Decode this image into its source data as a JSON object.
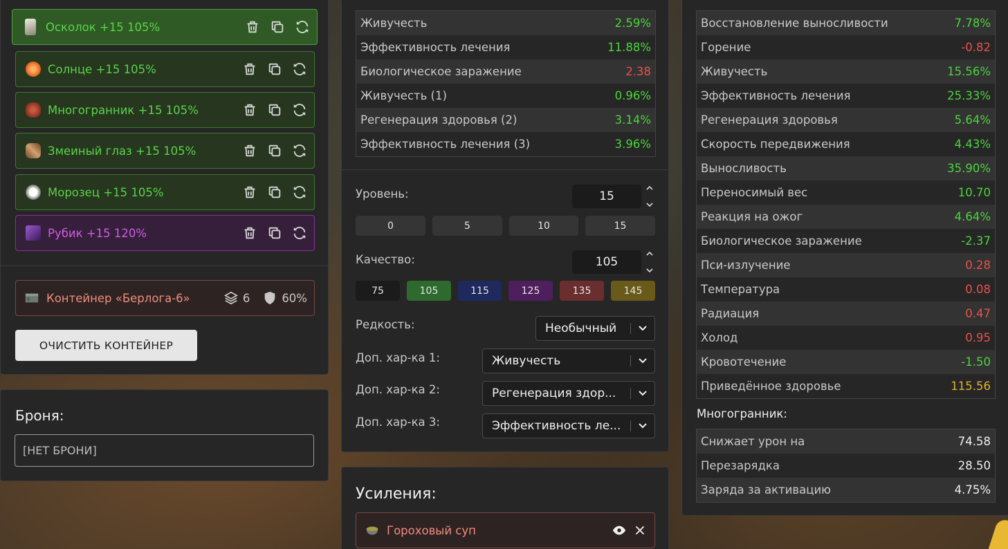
{
  "artifacts": [
    {
      "label": "Осколок +15 105%",
      "icon": "shard-icon",
      "color": "#c9c0b0",
      "style": "active"
    },
    {
      "label": "Солнце +15 105%",
      "icon": "sun-icon",
      "color": "#f08a2c",
      "style": "green"
    },
    {
      "label": "Многогранник +15 105%",
      "icon": "polyhedron-icon",
      "color": "#a8402c",
      "style": "green"
    },
    {
      "label": "Змеиный глаз +15 105%",
      "icon": "snake-eye-icon",
      "color": "#b07a48",
      "style": "green"
    },
    {
      "label": "Морозец +15 105%",
      "icon": "frost-icon",
      "color": "#f4f4f4",
      "style": "green"
    },
    {
      "label": "Рубик +15 120%",
      "icon": "rubik-icon",
      "color": "#7a3a9a",
      "style": "purple"
    }
  ],
  "container": {
    "label": "Контейнер «Берлога-6»",
    "slots": "6",
    "protection": "60%"
  },
  "clear_button": "ОЧИСТИТЬ КОНТЕЙНЕР",
  "armor": {
    "title": "Броня:",
    "value": "[НЕТ БРОНИ]"
  },
  "mid_stats": [
    {
      "label": "Живучесть",
      "value": "2.59%",
      "tone": "green"
    },
    {
      "label": "Эффективность лечения",
      "value": "11.88%",
      "tone": "green"
    },
    {
      "label": "Биологическое заражение",
      "value": "2.38",
      "tone": "red"
    },
    {
      "label": "Живучесть (1)",
      "value": "0.96%",
      "tone": "green"
    },
    {
      "label": "Регенерация здоровья (2)",
      "value": "3.14%",
      "tone": "green"
    },
    {
      "label": "Эффективность лечения (3)",
      "value": "3.96%",
      "tone": "green"
    }
  ],
  "level": {
    "label": "Уровень:",
    "value": "15",
    "presets": [
      "0",
      "5",
      "10",
      "15"
    ]
  },
  "quality": {
    "label": "Качество:",
    "value": "105",
    "presets": [
      {
        "label": "75",
        "color": "#1b1b1b"
      },
      {
        "label": "105",
        "color": "#2e6a2e"
      },
      {
        "label": "115",
        "color": "#1e2a5e"
      },
      {
        "label": "125",
        "color": "#4e1f5c"
      },
      {
        "label": "135",
        "color": "#6a2e2e"
      },
      {
        "label": "145",
        "color": "#6a5a1a"
      }
    ]
  },
  "rarity": {
    "label": "Редкость:",
    "value": "Необычный"
  },
  "extras": [
    {
      "label": "Доп. хар-ка 1:",
      "value": "Живучесть"
    },
    {
      "label": "Доп. хар-ка 2:",
      "value": "Регенерация здор..."
    },
    {
      "label": "Доп. хар-ка 3:",
      "value": "Эффективность ле..."
    }
  ],
  "boosts": {
    "title": "Усиления:",
    "item": "Гороховый суп"
  },
  "right_stats": [
    {
      "label": "Восстановление выносливости",
      "value": "7.78%",
      "tone": "green"
    },
    {
      "label": "Горение",
      "value": "-0.82",
      "tone": "red"
    },
    {
      "label": "Живучесть",
      "value": "15.56%",
      "tone": "green"
    },
    {
      "label": "Эффективность лечения",
      "value": "25.33%",
      "tone": "green"
    },
    {
      "label": "Регенерация здоровья",
      "value": "5.64%",
      "tone": "green"
    },
    {
      "label": "Скорость передвижения",
      "value": "4.43%",
      "tone": "green"
    },
    {
      "label": "Выносливость",
      "value": "35.90%",
      "tone": "green"
    },
    {
      "label": "Переносимый вес",
      "value": "10.70",
      "tone": "green"
    },
    {
      "label": "Реакция на ожог",
      "value": "4.64%",
      "tone": "green"
    },
    {
      "label": "Биологическое заражение",
      "value": "-2.37",
      "tone": "green"
    },
    {
      "label": "Пси-излучение",
      "value": "0.28",
      "tone": "red"
    },
    {
      "label": "Температура",
      "value": "0.08",
      "tone": "red"
    },
    {
      "label": "Радиация",
      "value": "0.47",
      "tone": "red"
    },
    {
      "label": "Холод",
      "value": "0.95",
      "tone": "red"
    },
    {
      "label": "Кровотечение",
      "value": "-1.50",
      "tone": "green"
    },
    {
      "label": "Приведённое здоровье",
      "value": "115.56",
      "tone": "yellow"
    }
  ],
  "polyhedron": {
    "title": "Многогранник:",
    "stats": [
      {
        "label": "Снижает урон на",
        "value": "74.58",
        "tone": "white"
      },
      {
        "label": "Перезарядка",
        "value": "28.50",
        "tone": "white"
      },
      {
        "label": "Заряда за активацию",
        "value": "4.75%",
        "tone": "white"
      }
    ]
  }
}
